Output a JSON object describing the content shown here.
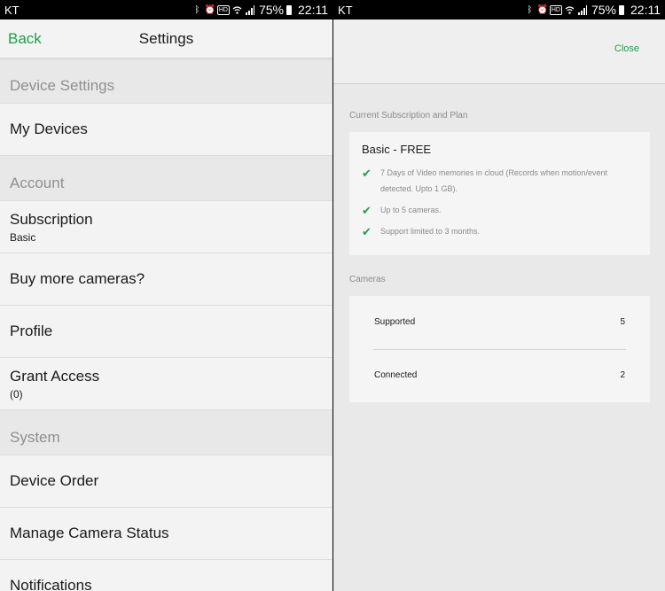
{
  "status_left": {
    "carrier": "KT",
    "battery_pct": "75%",
    "time": "22:11",
    "hd": "HD"
  },
  "status_right": {
    "carrier": "KT",
    "battery_pct": "75%",
    "time": "22:11",
    "hd": "HD"
  },
  "settings": {
    "back_label": "Back",
    "title": "Settings",
    "sections": [
      {
        "header": "Device Settings"
      },
      {
        "header": "Account"
      },
      {
        "header": "System"
      }
    ],
    "rows": {
      "my_devices": {
        "label": "My Devices"
      },
      "subscription": {
        "label": "Subscription",
        "value": "Basic"
      },
      "buy_cameras": {
        "label": "Buy more cameras?"
      },
      "profile": {
        "label": "Profile"
      },
      "grant_access": {
        "label": "Grant Access",
        "value": "(0)"
      },
      "device_order": {
        "label": "Device Order"
      },
      "manage_camera_status": {
        "label": "Manage Camera Status"
      },
      "notifications": {
        "label": "Notifications"
      }
    }
  },
  "subscription_detail": {
    "close_label": "Close",
    "plan_section_title": "Current Subscription and Plan",
    "plan_name": "Basic - FREE",
    "features": [
      "7 Days of Video memories in cloud (Records when motion/event detected. Upto 1 GB).",
      "Up to 5 cameras.",
      "Support limited to 3 months."
    ],
    "cameras_section_title": "Cameras",
    "cameras": {
      "supported_label": "Supported",
      "supported_value": "5",
      "connected_label": "Connected",
      "connected_value": "2"
    }
  },
  "colors": {
    "accent_green": "#1e9e4a",
    "section_gray": "#e8e8e8"
  },
  "icons": [
    "bluetooth-icon",
    "alarm-icon",
    "wifi-icon",
    "signal-icon",
    "battery-icon",
    "check-icon"
  ]
}
